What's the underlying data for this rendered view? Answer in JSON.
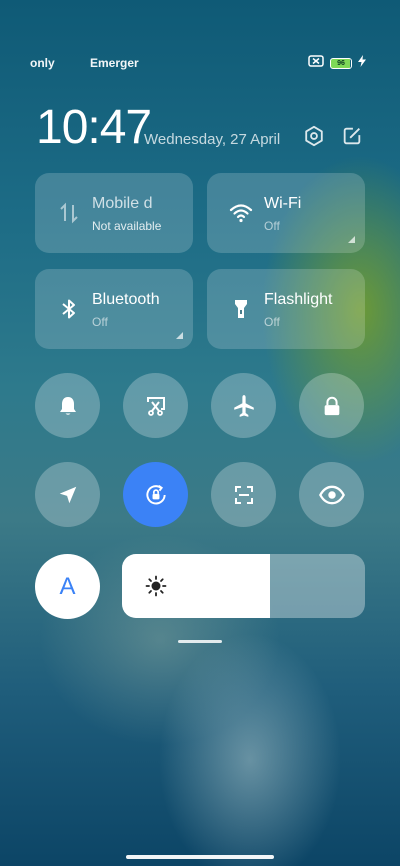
{
  "status_bar": {
    "carrier_1": "only",
    "carrier_2": "Emerger",
    "battery_level": "96"
  },
  "header": {
    "time": "10:47",
    "date": "Wednesday, 27 April"
  },
  "tiles": [
    {
      "title": "Mobile d",
      "subtitle": "Not available"
    },
    {
      "title": "Wi-Fi",
      "subtitle": "Off"
    },
    {
      "title": "Bluetooth",
      "subtitle": "Off"
    },
    {
      "title": "Flashlight",
      "subtitle": "Off"
    }
  ],
  "toggles_row1": [
    "bell-icon",
    "screenshot-icon",
    "airplane-icon",
    "lock-icon"
  ],
  "toggles_row2": [
    "location-icon",
    "rotation-lock-icon",
    "scanner-icon",
    "eye-icon"
  ],
  "auto_brightness_label": "A",
  "brightness_level": 0.61,
  "colors": {
    "accent": "#3b82f6",
    "tile_bg": "rgba(255,255,255,0.18)"
  }
}
